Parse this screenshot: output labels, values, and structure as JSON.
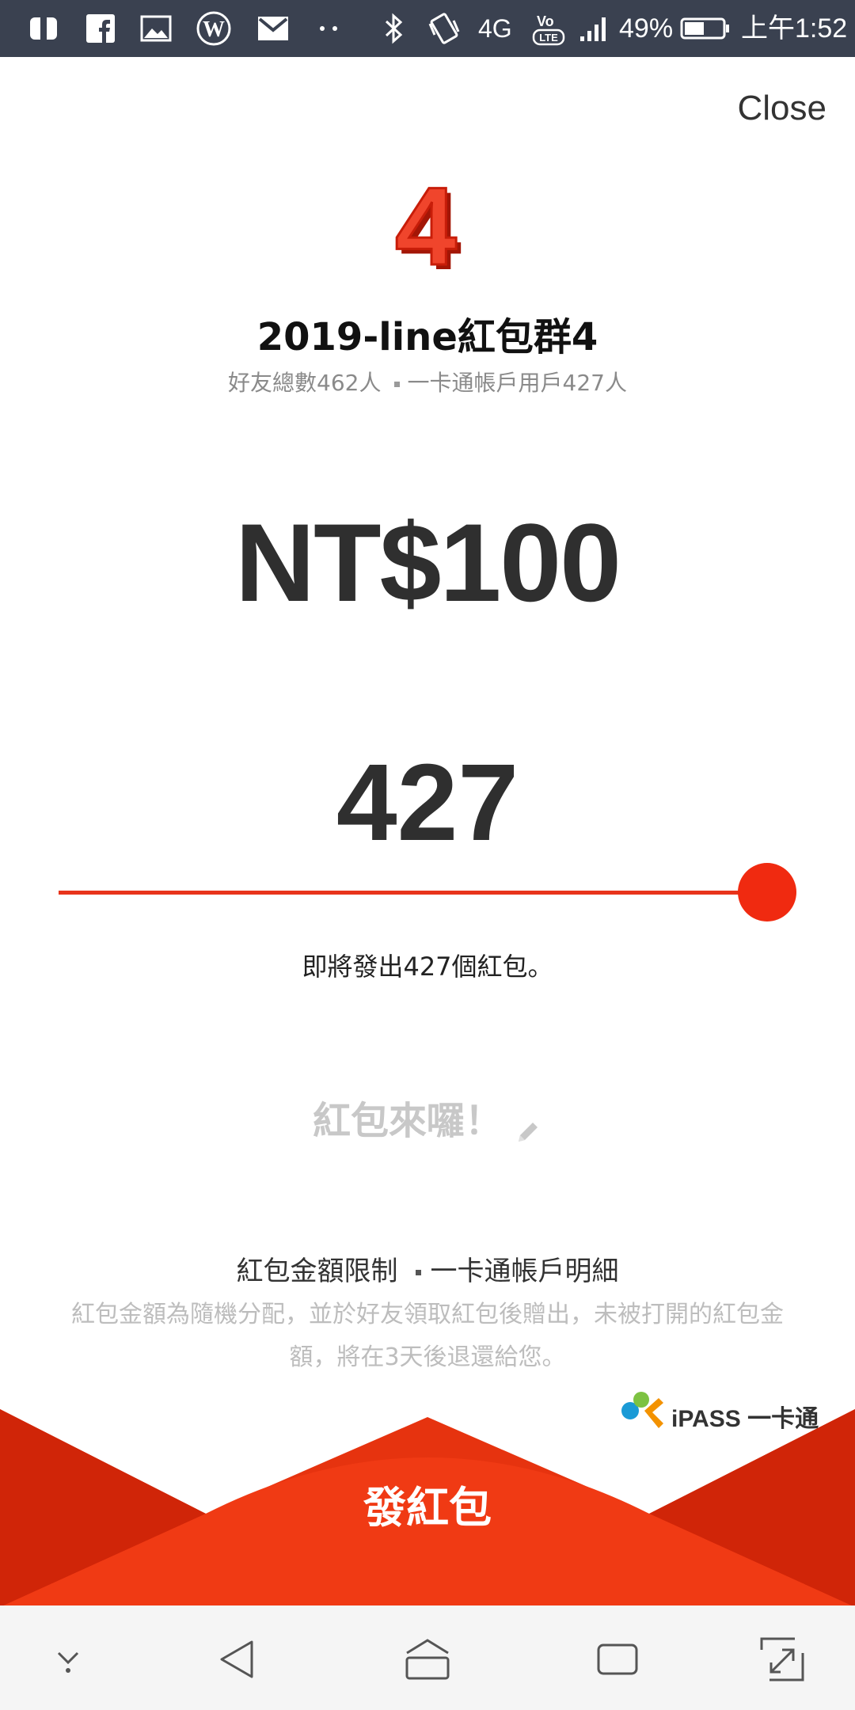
{
  "status_bar": {
    "battery": "49%",
    "time": "上午1:52",
    "network": "4G",
    "icons": [
      "app-icon",
      "facebook-icon",
      "gallery-icon",
      "wordpress-icon",
      "mail-icon",
      "more-dots-icon",
      "bluetooth-icon",
      "vibrate-icon",
      "4g-icon",
      "volte-icon",
      "signal-icon",
      "battery-icon"
    ]
  },
  "header": {
    "close_label": "Close"
  },
  "group": {
    "badge_number": "4",
    "name": "2019-line紅包群4",
    "friends_total": "好友總數462人",
    "ipass_users": "一卡通帳戶用戶427人"
  },
  "red_envelope": {
    "amount": "NT$100",
    "count": "427",
    "slider_fraction": 1.0,
    "send_note": "即將發出427個紅包。",
    "message_placeholder": "紅包來囉！"
  },
  "footer": {
    "link_limit": "紅包金額限制",
    "link_account": "一卡通帳戶明細",
    "notice": "紅包金額為隨機分配，並於好友領取紅包後贈出，未被打開的紅包金額，將在3天後退還給您。",
    "brand_text": "iPASS 一卡通",
    "send_label": "發紅包"
  },
  "colors": {
    "accent": "#f02a10",
    "envelope": "#e6330f",
    "envelope_dark": "#d02508"
  },
  "nav_bar": {
    "icons": [
      "hide-nav-icon",
      "back-icon",
      "home-icon",
      "recents-icon",
      "expand-icon"
    ]
  }
}
